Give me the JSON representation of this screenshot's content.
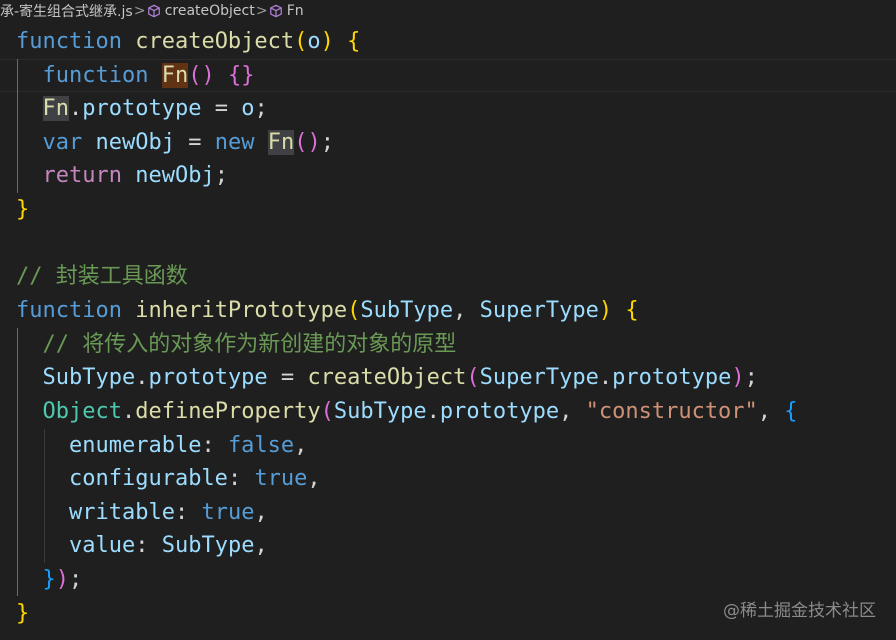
{
  "breadcrumb": {
    "file_label": "承-寄生组合式继承.js",
    "crumbs": [
      "createObject",
      "Fn"
    ],
    "separator": ">"
  },
  "code": {
    "l1": {
      "kw": "function",
      "fn": "createObject",
      "p_open": "(",
      "param": "o",
      "p_close": ")",
      "brace": "{"
    },
    "l2": {
      "kw": "function",
      "fn": "Fn",
      "parens": "()",
      "braces": "{}"
    },
    "l3": {
      "obj": "Fn",
      "dot": ".",
      "prop": "prototype",
      "eq": " = ",
      "val": "o",
      "semi": ";"
    },
    "l4": {
      "kw": "var",
      "name": "newObj",
      "eq": " = ",
      "new_kw": "new",
      "fn": "Fn",
      "parens": "()",
      "semi": ";"
    },
    "l5": {
      "kw": "return",
      "val": "newObj",
      "semi": ";"
    },
    "l6": {
      "brace": "}"
    },
    "l8": {
      "comment": "// 封装工具函数"
    },
    "l9": {
      "kw": "function",
      "fn": "inheritPrototype",
      "p_open": "(",
      "a1": "SubType",
      "comma": ", ",
      "a2": "SuperType",
      "p_close": ")",
      "brace": "{"
    },
    "l10": {
      "comment": "// 将传入的对象作为新创建的对象的原型"
    },
    "l11": {
      "obj": "SubType",
      "dot": ".",
      "prop": "prototype",
      "eq": " = ",
      "fn": "createObject",
      "p_open": "(",
      "arg_obj": "SuperType",
      "arg_dot": ".",
      "arg_prop": "prototype",
      "p_close": ")",
      "semi": ";"
    },
    "l12": {
      "obj": "Object",
      "dot": ".",
      "fn": "defineProperty",
      "p_open": "(",
      "a_obj": "SubType",
      "a_dot": ".",
      "a_prop": "prototype",
      "comma1": ", ",
      "str": "\"constructor\"",
      "comma2": ", ",
      "brace": "{"
    },
    "l13": {
      "key": "enumerable",
      "colon": ": ",
      "val": "false",
      "comma": ","
    },
    "l14": {
      "key": "configurable",
      "colon": ": ",
      "val": "true",
      "comma": ","
    },
    "l15": {
      "key": "writable",
      "colon": ": ",
      "val": "true",
      "comma": ","
    },
    "l16": {
      "key": "value",
      "colon": ": ",
      "val": "SubType",
      "comma": ","
    },
    "l17": {
      "brace": "}",
      "paren": ")",
      "semi": ";"
    },
    "l18": {
      "brace": "}"
    }
  },
  "watermark": "@稀土掘金技术社区"
}
